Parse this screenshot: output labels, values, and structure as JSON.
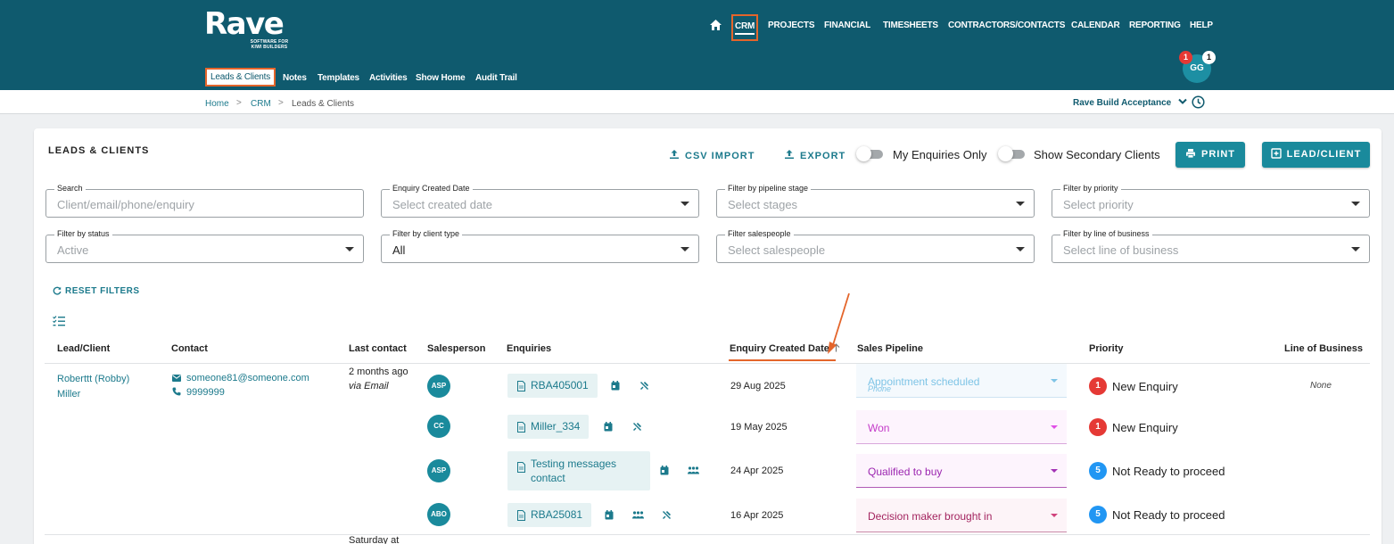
{
  "brand": {
    "logo": "Rave",
    "tagline": "SOFTWARE FOR KIWI BUILDERS"
  },
  "nav": {
    "items": [
      "CRM",
      "PROJECTS",
      "FINANCIAL",
      "TIMESHEETS",
      "CONTRACTORS/CONTACTS",
      "CALENDAR",
      "REPORTING",
      "HELP"
    ],
    "active": "CRM"
  },
  "subnav": {
    "items": [
      "Leads & Clients",
      "Notes",
      "Templates",
      "Activities",
      "Show Home",
      "Audit Trail"
    ],
    "active": "Leads & Clients"
  },
  "user": {
    "initials": "GG",
    "notifications": "1",
    "messages": "1"
  },
  "breadcrumb": {
    "items": [
      "Home",
      "CRM",
      "Leads & Clients"
    ],
    "separator": ">"
  },
  "account": {
    "name": "Rave Build Acceptance"
  },
  "card": {
    "title": "LEADS & CLIENTS",
    "csv_import": "CSV IMPORT",
    "export": "EXPORT",
    "toggle_my_enquiries": "My Enquiries Only",
    "toggle_secondary": "Show Secondary Clients",
    "print": "PRINT",
    "add": "LEAD/CLIENT"
  },
  "filters": [
    {
      "label": "Search",
      "value": "Client/email/phone/enquiry",
      "placeholder": true
    },
    {
      "label": "Enquiry Created Date",
      "value": "Select created date",
      "placeholder": true
    },
    {
      "label": "Filter by pipeline stage",
      "value": "Select stages",
      "placeholder": true
    },
    {
      "label": "Filter by priority",
      "value": "Select priority",
      "placeholder": true
    },
    {
      "label": "Filter by status",
      "value": "Active",
      "placeholder": true
    },
    {
      "label": "Filter by client type",
      "value": "All",
      "placeholder": false
    },
    {
      "label": "Filter salespeople",
      "value": "Select salespeople",
      "placeholder": true
    },
    {
      "label": "Filter by line of business",
      "value": "Select line of business",
      "placeholder": true
    }
  ],
  "reset_filters": "RESET FILTERS",
  "table": {
    "columns": [
      "Lead/Client",
      "Contact",
      "Last contact",
      "Salesperson",
      "Enquiries",
      "Enquiry Created Date",
      "Sales Pipeline",
      "Priority",
      "Line of Business"
    ],
    "client": {
      "name": "Roberttt (Robby) Miller",
      "email": "someone81@someone.com",
      "phone": "9999999",
      "last_contact": "2 months ago",
      "last_contact_via": "via Email",
      "line_of_business": "None"
    },
    "enquiries": [
      {
        "salesperson": "ASP",
        "enquiry": "RBA405001",
        "date": "29 Aug 2025",
        "pipeline": "Appointment scheduled",
        "pipeline_sub": "Phone",
        "priority_num": "1",
        "priority": "New Enquiry"
      },
      {
        "salesperson": "CC",
        "enquiry": "Miller_334",
        "date": "19 May 2025",
        "pipeline": "Won",
        "pipeline_sub": "",
        "priority_num": "1",
        "priority": "New Enquiry"
      },
      {
        "salesperson": "ASP",
        "enquiry": "Testing messages contact",
        "date": "24 Apr 2025",
        "pipeline": "Qualified to buy",
        "pipeline_sub": "",
        "priority_num": "5",
        "priority": "Not Ready to proceed"
      },
      {
        "salesperson": "ABO",
        "enquiry": "RBA25081",
        "date": "16 Apr 2025",
        "pipeline": "Decision maker brought in",
        "pipeline_sub": "",
        "priority_num": "5",
        "priority": "Not Ready to proceed"
      }
    ],
    "next_last_contact": "Saturday at"
  },
  "colors": {
    "header": "#0f5a6e",
    "accent": "#1a8a9c",
    "highlight": "#e4652b",
    "priority_red": "#e53935",
    "priority_blue": "#2196f3"
  }
}
